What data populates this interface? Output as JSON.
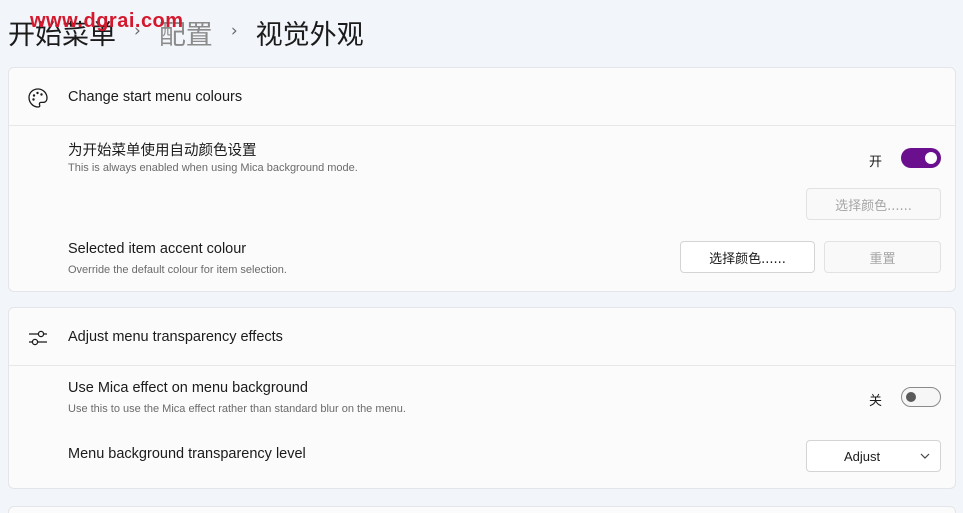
{
  "watermark": "www.dgrai.com",
  "breadcrumb": {
    "items": [
      "开始菜单",
      "配置",
      "视觉外观"
    ],
    "separator": "›"
  },
  "colour_card": {
    "header": {
      "icon": "palette-icon",
      "title": "Change start menu colours"
    },
    "auto_colour": {
      "title": "为开始菜单使用自动颜色设置",
      "description": "This is always enabled when using Mica background mode.",
      "toggle_label": "开",
      "toggle_on": true,
      "accent": "#6a0f8e",
      "pick_button": "选择颜色......"
    },
    "accent_colour": {
      "title": "Selected item accent colour",
      "description": "Override the default colour for item selection.",
      "pick_button": "选择颜色......",
      "reset_button": "重置"
    }
  },
  "transparency_card": {
    "header": {
      "icon": "sliders-icon",
      "title": "Adjust menu transparency effects"
    },
    "mica": {
      "title": "Use Mica effect on menu background",
      "description": "Use this to use the Mica effect rather than standard blur on the menu.",
      "toggle_label": "关",
      "toggle_on": false
    },
    "level": {
      "title": "Menu background transparency level",
      "selected": "Adjust"
    }
  }
}
